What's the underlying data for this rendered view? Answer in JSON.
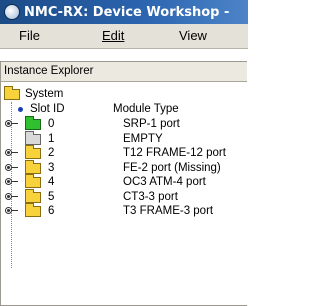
{
  "window": {
    "title": "NMC-RX: Device Workshop -",
    "icon": "nmc-app-icon"
  },
  "menu": [
    {
      "label": "File"
    },
    {
      "label": "Edit"
    },
    {
      "label": "View"
    }
  ],
  "panel": {
    "title": "Instance Explorer"
  },
  "tree": {
    "root": "System",
    "columns": {
      "slot_id": "Slot ID",
      "module_type": "Module Type"
    },
    "slots": [
      {
        "id": "0",
        "module": "SRP-1 port",
        "folder_color": "green",
        "expandable": true
      },
      {
        "id": "1",
        "module": "EMPTY",
        "folder_color": "gray",
        "expandable": false
      },
      {
        "id": "2",
        "module": "T12 FRAME-12 port",
        "folder_color": "yellow",
        "expandable": true
      },
      {
        "id": "3",
        "module": "FE-2 port (Missing)",
        "folder_color": "yellow",
        "expandable": true
      },
      {
        "id": "4",
        "module": "OC3 ATM-4 port",
        "folder_color": "yellow",
        "expandable": true
      },
      {
        "id": "5",
        "module": "CT3-3 port",
        "folder_color": "yellow",
        "expandable": true
      },
      {
        "id": "6",
        "module": "T3 FRAME-3 port",
        "folder_color": "yellow",
        "expandable": true
      }
    ]
  }
}
